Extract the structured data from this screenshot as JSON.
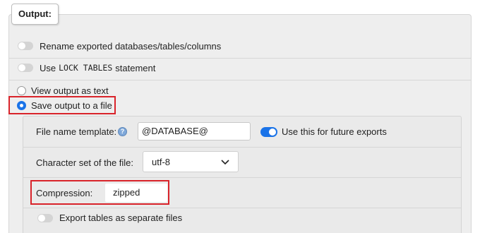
{
  "output": {
    "legend": "Output:",
    "rename_label": "Rename exported databases/tables/columns",
    "lock_prefix": "Use",
    "lock_code": "LOCK TABLES",
    "lock_suffix": "statement",
    "view_as_text": "View output as text",
    "save_to_file": "Save output to a file"
  },
  "save": {
    "filename_label": "File name template:",
    "filename_value": "@DATABASE@",
    "future_label": "Use this for future exports",
    "charset_label": "Character set of the file:",
    "charset_value": "utf-8",
    "compression_label": "Compression:",
    "compression_value": "zipped",
    "separate_label": "Export tables as separate files"
  },
  "colors": {
    "accent": "#1a73e8",
    "highlight_border": "#d9232a",
    "panel_bg": "#eeeeee"
  }
}
